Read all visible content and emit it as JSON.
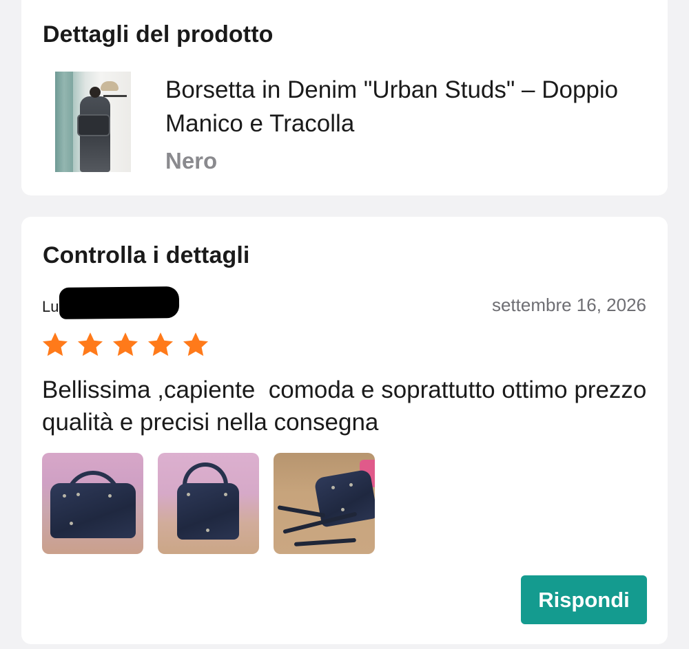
{
  "product_details": {
    "title": "Dettagli del prodotto",
    "product_name": "Borsetta in Denim \"Urban Studs\" – Doppio Manico e Tracolla",
    "variant": "Nero"
  },
  "review": {
    "section_title": "Controlla i dettagli",
    "reviewer_name": "Lu",
    "date": "settembre 16, 2026",
    "rating": 5,
    "rating_max": 5,
    "text": "Bellissima ,capiente  comoda e soprattutto ottimo prezzo qualità e precisi nella consegna",
    "photo_count": 3,
    "reply_label": "Rispondi"
  },
  "colors": {
    "background": "#f2f2f4",
    "card": "#ffffff",
    "star": "#ff7a1a",
    "reply_button": "#149b8f",
    "muted_text": "#8a8a8e",
    "date_text": "#6e6e73"
  },
  "icons": {
    "star": "star-icon"
  }
}
